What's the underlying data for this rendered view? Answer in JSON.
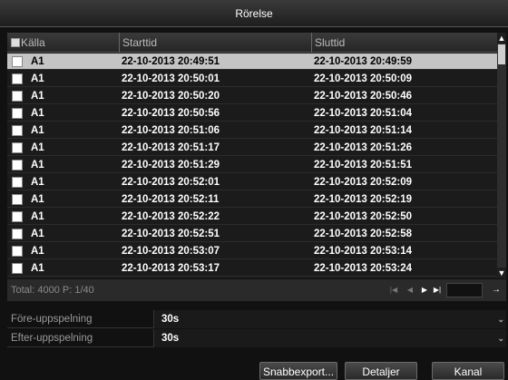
{
  "title": "Rörelse",
  "table": {
    "columns": [
      "Källa",
      "Starttid",
      "Sluttid"
    ],
    "rows": [
      {
        "source": "A1",
        "start": "22-10-2013 20:49:51",
        "end": "22-10-2013 20:49:59",
        "selected": true
      },
      {
        "source": "A1",
        "start": "22-10-2013 20:50:01",
        "end": "22-10-2013 20:50:09"
      },
      {
        "source": "A1",
        "start": "22-10-2013 20:50:20",
        "end": "22-10-2013 20:50:46"
      },
      {
        "source": "A1",
        "start": "22-10-2013 20:50:56",
        "end": "22-10-2013 20:51:04"
      },
      {
        "source": "A1",
        "start": "22-10-2013 20:51:06",
        "end": "22-10-2013 20:51:14"
      },
      {
        "source": "A1",
        "start": "22-10-2013 20:51:17",
        "end": "22-10-2013 20:51:26"
      },
      {
        "source": "A1",
        "start": "22-10-2013 20:51:29",
        "end": "22-10-2013 20:51:51"
      },
      {
        "source": "A1",
        "start": "22-10-2013 20:52:01",
        "end": "22-10-2013 20:52:09"
      },
      {
        "source": "A1",
        "start": "22-10-2013 20:52:11",
        "end": "22-10-2013 20:52:19"
      },
      {
        "source": "A1",
        "start": "22-10-2013 20:52:22",
        "end": "22-10-2013 20:52:50"
      },
      {
        "source": "A1",
        "start": "22-10-2013 20:52:51",
        "end": "22-10-2013 20:52:58"
      },
      {
        "source": "A1",
        "start": "22-10-2013 20:53:07",
        "end": "22-10-2013 20:53:14"
      },
      {
        "source": "A1",
        "start": "22-10-2013 20:53:17",
        "end": "22-10-2013 20:53:24"
      }
    ]
  },
  "pager": {
    "status": "Total: 4000  P: 1/40",
    "first_icon": "skip-to-first-icon",
    "prev_icon": "previous-page-icon",
    "next_icon": "next-page-icon",
    "last_icon": "skip-to-last-icon",
    "page_value": "",
    "go_icon": "go-arrow-icon"
  },
  "pre_playback": {
    "label": "Före-uppspelning",
    "value": "30s"
  },
  "post_playback": {
    "label": "Efter-uppspelning",
    "value": "30s"
  },
  "buttons": {
    "quick_export": "Snabbexport...",
    "details": "Detaljer",
    "channel": "Kanal"
  },
  "colors": {
    "selected_row": "#c4c4c4",
    "background": "#111111"
  }
}
